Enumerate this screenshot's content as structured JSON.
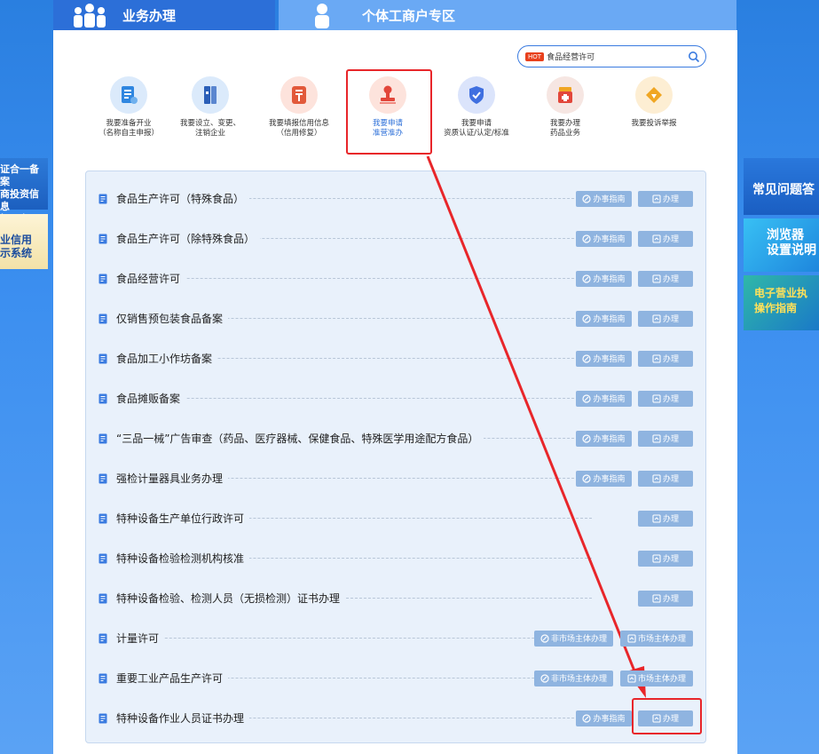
{
  "tabs": [
    {
      "label": "业务办理"
    },
    {
      "label": "个体工商户专区"
    }
  ],
  "search": {
    "hot_badge": "HOT",
    "value": "食品经营许可"
  },
  "services": [
    {
      "label": "我要准备开业\n（名称自主申报）",
      "icon": "document-edit-icon",
      "color": "#2f86e0"
    },
    {
      "label": "我要设立、变更、\n注销企业",
      "icon": "binder-icon",
      "color": "#2b5fb8"
    },
    {
      "label": "我要填报信用信息\n（信用修复）",
      "icon": "credit-icon",
      "color": "#e2593a"
    },
    {
      "label": "我要申请\n准营准办",
      "icon": "stamp-icon",
      "color": "#e2463a"
    },
    {
      "label": "我要申请\n资质认证/认定/标准",
      "icon": "shield-check-icon",
      "color": "#3f6fe0"
    },
    {
      "label": "我要办理\n药品业务",
      "icon": "medicine-icon",
      "color": "#e2463a"
    },
    {
      "label": "我要投诉举报",
      "icon": "complaint-icon",
      "color": "#f0a623"
    }
  ],
  "button_labels": {
    "guide": "办事指南",
    "handle": "办理",
    "non_market": "非市场主体办理",
    "market": "市场主体办理"
  },
  "rows": [
    {
      "name": "食品生产许可（特殊食品）",
      "buttons": [
        "guide",
        "handle"
      ]
    },
    {
      "name": "食品生产许可（除特殊食品）",
      "buttons": [
        "guide",
        "handle"
      ]
    },
    {
      "name": "食品经营许可",
      "buttons": [
        "guide",
        "handle"
      ]
    },
    {
      "name": "仅销售预包装食品备案",
      "buttons": [
        "guide",
        "handle"
      ]
    },
    {
      "name": "食品加工小作坊备案",
      "buttons": [
        "guide",
        "handle"
      ]
    },
    {
      "name": "食品摊贩备案",
      "buttons": [
        "guide",
        "handle"
      ]
    },
    {
      "name": "“三品一械”广告审查（药品、医疗器械、保健食品、特殊医学用途配方食品）",
      "buttons": [
        "guide",
        "handle"
      ]
    },
    {
      "name": "强检计量器具业务办理",
      "buttons": [
        "guide",
        "handle"
      ]
    },
    {
      "name": "特种设备生产单位行政许可",
      "buttons": [
        "handle"
      ]
    },
    {
      "name": "特种设备检验检测机构核准",
      "buttons": [
        "handle"
      ]
    },
    {
      "name": "特种设备检验、检测人员（无损检测）证书办理",
      "buttons": [
        "handle"
      ]
    },
    {
      "name": "计量许可",
      "buttons": [
        "non_market",
        "market"
      ]
    },
    {
      "name": "重要工业产品生产许可",
      "buttons": [
        "non_market",
        "market"
      ]
    },
    {
      "name": "特种设备作业人员证书办理",
      "buttons": [
        "guide",
        "handle"
      ]
    }
  ],
  "left_banners": {
    "banner1": "证合一备案\n商投资信息\n报平台",
    "banner2": "业信用\n示系统"
  },
  "right_banners": {
    "faq": "常见问题答",
    "browser": "浏览器\n设置说明",
    "license": "电子营业执\n操作指南"
  },
  "colors": {
    "accent": "#2c6fd8",
    "highlight": "#e8262a",
    "button": "#8fb4e0"
  }
}
